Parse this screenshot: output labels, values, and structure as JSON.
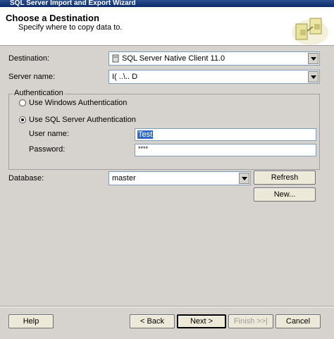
{
  "window": {
    "title": "SQL Server Import and Export Wizard"
  },
  "header": {
    "title": "Choose a Destination",
    "subtitle": "Specify where to copy data to."
  },
  "form": {
    "destination_label": "Destination:",
    "destination_value": "SQL Server Native Client 11.0",
    "server_label": "Server name:",
    "server_value": "I( ..\\.. D",
    "auth_group_title": "Authentication",
    "windows_auth_label": "Use Windows Authentication",
    "sql_auth_label": "Use SQL Server Authentication",
    "username_label": "User name:",
    "username_value": "Test",
    "password_label": "Password:",
    "password_value": "****",
    "database_label": "Database:",
    "database_value": "master",
    "refresh_label": "Refresh",
    "new_label": "New..."
  },
  "footer": {
    "help_label": "Help",
    "back_label": "< Back",
    "next_label": "Next >",
    "finish_label": "Finish >>|",
    "cancel_label": "Cancel"
  }
}
